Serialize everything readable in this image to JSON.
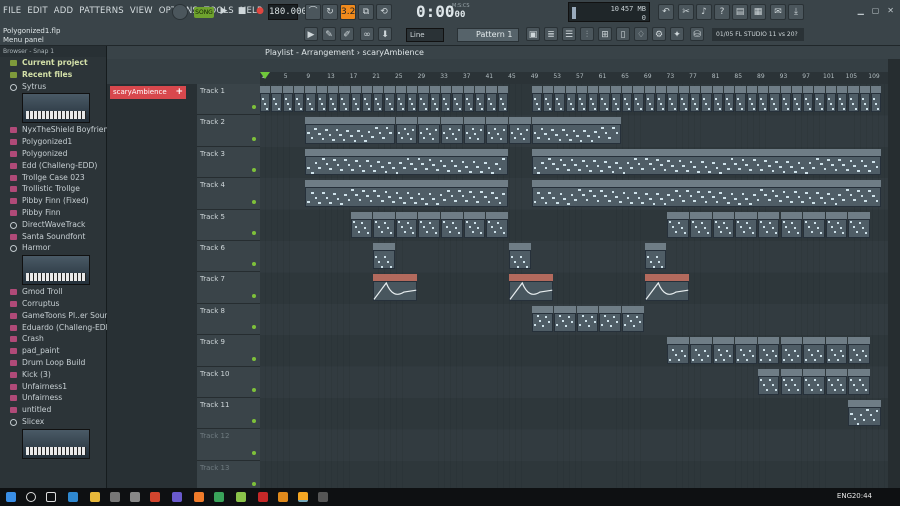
{
  "menu": [
    "FILE",
    "EDIT",
    "ADD",
    "PATTERNS",
    "VIEW",
    "OPTIONS",
    "TOOLS",
    "HELP"
  ],
  "project": {
    "file": "Polygonized1.flp",
    "hint": "Menu panel"
  },
  "transport": {
    "song_label": "SONG",
    "bpm": "180.000",
    "time": "0:00",
    "time_small": "00",
    "mcs": "M:S:CS"
  },
  "cpu": {
    "cores": "10",
    "memory": "457 MB",
    "polyphony": "0"
  },
  "tool_strip": {
    "step_badge": "3.2",
    "line_mode": "Line",
    "pattern": "Pattern 1"
  },
  "news": "01/05  FL STUDIO 11 vs 20?",
  "browser": {
    "header": "Browser - Snap 1",
    "items": [
      {
        "label": "Current project",
        "kind": "sect"
      },
      {
        "label": "Recent files",
        "kind": "sect"
      },
      {
        "label": "Sytrus",
        "kind": "gear"
      },
      {
        "label": "",
        "kind": "thumb"
      },
      {
        "label": "NyxTheShield Boyfriend",
        "kind": "file"
      },
      {
        "label": "Polygonized1",
        "kind": "file"
      },
      {
        "label": "Polygonized",
        "kind": "file"
      },
      {
        "label": "Edd (Challeng-EDD)",
        "kind": "file"
      },
      {
        "label": "Trollge Case 023",
        "kind": "file"
      },
      {
        "label": "Trollistic Trollge",
        "kind": "file"
      },
      {
        "label": "Pibby Finn (Fixed)",
        "kind": "file"
      },
      {
        "label": "Pibby Finn",
        "kind": "file"
      },
      {
        "label": "DirectWaveTrack",
        "kind": "gear"
      },
      {
        "label": "Santa Soundfont",
        "kind": "file"
      },
      {
        "label": "Harmor",
        "kind": "gear"
      },
      {
        "label": "",
        "kind": "thumb"
      },
      {
        "label": "Gmod Troll",
        "kind": "file"
      },
      {
        "label": "Corruptus",
        "kind": "file"
      },
      {
        "label": "GameToons Pl..er Soundfont",
        "kind": "file"
      },
      {
        "label": "Eduardo (Challeng-EDD)",
        "kind": "file"
      },
      {
        "label": "Crash",
        "kind": "file"
      },
      {
        "label": "pad_paint",
        "kind": "file"
      },
      {
        "label": "Drum Loop Build",
        "kind": "file"
      },
      {
        "label": "Kick (3)",
        "kind": "file"
      },
      {
        "label": "Unfairness1",
        "kind": "file"
      },
      {
        "label": "Unfairness",
        "kind": "file"
      },
      {
        "label": "untitled",
        "kind": "file"
      },
      {
        "label": "Slicex",
        "kind": "gear"
      },
      {
        "label": "",
        "kind": "thumb"
      }
    ]
  },
  "playlist": {
    "title": "Playlist - Arrangement",
    "breadcrumb_sep": "›",
    "current": "scaryAmbience",
    "picker_item": "scaryAmbience",
    "bars": [
      "1",
      "5",
      "9",
      "13",
      "17",
      "21",
      "25",
      "29",
      "33",
      "37",
      "41",
      "45",
      "49",
      "53",
      "57",
      "61",
      "65",
      "69",
      "73",
      "77",
      "81",
      "85",
      "89",
      "93",
      "97",
      "101",
      "105",
      "109"
    ],
    "tracks": [
      "Track 1",
      "Track 2",
      "Track 3",
      "Track 4",
      "Track 5",
      "Track 6",
      "Track 7",
      "Track 8",
      "Track 9",
      "Track 10",
      "Track 11",
      "Track 12",
      "Track 13"
    ],
    "clips": [
      {
        "track": 1,
        "start": 1,
        "len": 2,
        "label": "Pa..5"
      },
      {
        "track": 1,
        "start": 3,
        "len": 2,
        "label": "Pa..3"
      },
      {
        "track": 1,
        "start": 5,
        "len": 2,
        "label": "Pa..5"
      },
      {
        "track": 1,
        "start": 7,
        "len": 2,
        "label": "Pa..5"
      },
      {
        "track": 1,
        "start": 9,
        "len": 2,
        "label": "Pa..3"
      },
      {
        "track": 1,
        "start": 11,
        "len": 2,
        "label": "Pa..5"
      },
      {
        "track": 1,
        "start": 13,
        "len": 2,
        "label": "Pa..5"
      },
      {
        "track": 1,
        "start": 15,
        "len": 2,
        "label": "Pa..3"
      },
      {
        "track": 1,
        "start": 17,
        "len": 2,
        "label": "Pa..5"
      },
      {
        "track": 1,
        "start": 19,
        "len": 2,
        "label": "Pa..5"
      },
      {
        "track": 1,
        "start": 21,
        "len": 2,
        "label": "Pa..3"
      },
      {
        "track": 1,
        "start": 23,
        "len": 2,
        "label": "Pa..5"
      },
      {
        "track": 1,
        "start": 25,
        "len": 2,
        "label": "Pa..5"
      },
      {
        "track": 1,
        "start": 27,
        "len": 2,
        "label": "Pa..3"
      },
      {
        "track": 1,
        "start": 29,
        "len": 2,
        "label": "Pa..5"
      },
      {
        "track": 1,
        "start": 31,
        "len": 2,
        "label": "Pa..5"
      },
      {
        "track": 1,
        "start": 33,
        "len": 2,
        "label": "Pa..3"
      },
      {
        "track": 1,
        "start": 35,
        "len": 2,
        "label": "Pa..5"
      },
      {
        "track": 1,
        "start": 37,
        "len": 2,
        "label": "Pa..5"
      },
      {
        "track": 1,
        "start": 39,
        "len": 2,
        "label": "Pa..3"
      },
      {
        "track": 1,
        "start": 41,
        "len": 2,
        "label": "Pa..5"
      },
      {
        "track": 1,
        "start": 43,
        "len": 2,
        "label": "Pa..5"
      },
      {
        "track": 1,
        "start": 49,
        "len": 2,
        "label": "Pa..5"
      },
      {
        "track": 1,
        "start": 51,
        "len": 2,
        "label": "Pa..5"
      },
      {
        "track": 1,
        "start": 53,
        "len": 2,
        "label": "Pa..3"
      },
      {
        "track": 1,
        "start": 55,
        "len": 2,
        "label": "Pa..5"
      },
      {
        "track": 1,
        "start": 57,
        "len": 2,
        "label": "Pa..5"
      },
      {
        "track": 1,
        "start": 59,
        "len": 2,
        "label": "Pa..3"
      },
      {
        "track": 1,
        "start": 61,
        "len": 2,
        "label": "Pa..5"
      },
      {
        "track": 1,
        "start": 63,
        "len": 2,
        "label": "Pa..5"
      },
      {
        "track": 1,
        "start": 65,
        "len": 2,
        "label": "Pa..3"
      },
      {
        "track": 1,
        "start": 67,
        "len": 2,
        "label": "Pa..5"
      },
      {
        "track": 1,
        "start": 69,
        "len": 2,
        "label": "Pa..5"
      },
      {
        "track": 1,
        "start": 71,
        "len": 2,
        "label": "Pa..3"
      },
      {
        "track": 1,
        "start": 73,
        "len": 2,
        "label": "Pa..5"
      },
      {
        "track": 1,
        "start": 75,
        "len": 2,
        "label": "Pa..5"
      },
      {
        "track": 1,
        "start": 77,
        "len": 2,
        "label": "Pa..3"
      },
      {
        "track": 1,
        "start": 79,
        "len": 2,
        "label": "Pa..5"
      },
      {
        "track": 1,
        "start": 81,
        "len": 2,
        "label": "Pa..5"
      },
      {
        "track": 1,
        "start": 83,
        "len": 2,
        "label": "Pa..3"
      },
      {
        "track": 1,
        "start": 85,
        "len": 2,
        "label": "Pa..5"
      },
      {
        "track": 1,
        "start": 87,
        "len": 2,
        "label": "Pa..5"
      },
      {
        "track": 1,
        "start": 89,
        "len": 2,
        "label": "Pa..3"
      },
      {
        "track": 1,
        "start": 91,
        "len": 2,
        "label": "Pa..5"
      },
      {
        "track": 1,
        "start": 93,
        "len": 2,
        "label": "Pa..5"
      },
      {
        "track": 1,
        "start": 95,
        "len": 2,
        "label": "Pa..3"
      },
      {
        "track": 1,
        "start": 97,
        "len": 2,
        "label": "Pa..5"
      },
      {
        "track": 1,
        "start": 99,
        "len": 2,
        "label": "Pa..5"
      },
      {
        "track": 1,
        "start": 101,
        "len": 2,
        "label": "Pa..3"
      },
      {
        "track": 1,
        "start": 103,
        "len": 2,
        "label": "Pa..5"
      },
      {
        "track": 1,
        "start": 105,
        "len": 2,
        "label": "Pa..5"
      },
      {
        "track": 1,
        "start": 107,
        "len": 2,
        "label": "Pa..3"
      },
      {
        "track": 1,
        "start": 109,
        "len": 2,
        "label": "Pa..5"
      },
      {
        "track": 2,
        "start": 9,
        "len": 16,
        "label": "Pattern 1"
      },
      {
        "track": 2,
        "start": 25,
        "len": 4,
        "label": "Pa..6"
      },
      {
        "track": 2,
        "start": 29,
        "len": 4,
        "label": "Pa..6"
      },
      {
        "track": 2,
        "start": 33,
        "len": 4,
        "label": "Pa..6"
      },
      {
        "track": 2,
        "start": 37,
        "len": 4,
        "label": "Pa..6"
      },
      {
        "track": 2,
        "start": 41,
        "len": 4,
        "label": "Pa..6"
      },
      {
        "track": 2,
        "start": 45,
        "len": 4,
        "label": "Pa..6"
      },
      {
        "track": 2,
        "start": 49,
        "len": 16,
        "label": "Pattern 1"
      },
      {
        "track": 3,
        "start": 9,
        "len": 36,
        "label": ""
      },
      {
        "track": 3,
        "start": 49,
        "len": 62,
        "label": ""
      },
      {
        "track": 4,
        "start": 9,
        "len": 36,
        "label": ""
      },
      {
        "track": 4,
        "start": 49,
        "len": 62,
        "label": ""
      },
      {
        "track": 5,
        "start": 17,
        "len": 4,
        "label": "pad"
      },
      {
        "track": 5,
        "start": 21,
        "len": 4,
        "label": "pad"
      },
      {
        "track": 5,
        "start": 25,
        "len": 4,
        "label": "pad"
      },
      {
        "track": 5,
        "start": 29,
        "len": 4,
        "label": "pad"
      },
      {
        "track": 5,
        "start": 33,
        "len": 4,
        "label": "pad"
      },
      {
        "track": 5,
        "start": 37,
        "len": 4,
        "label": "pad"
      },
      {
        "track": 5,
        "start": 41,
        "len": 4,
        "label": "pad"
      },
      {
        "track": 5,
        "start": 73,
        "len": 4,
        "label": "pad"
      },
      {
        "track": 5,
        "start": 77,
        "len": 4,
        "label": "pad"
      },
      {
        "track": 5,
        "start": 81,
        "len": 4,
        "label": "pad"
      },
      {
        "track": 5,
        "start": 85,
        "len": 4,
        "label": "pad"
      },
      {
        "track": 5,
        "start": 89,
        "len": 4,
        "label": "pad"
      },
      {
        "track": 5,
        "start": 93,
        "len": 4,
        "label": "pad"
      },
      {
        "track": 5,
        "start": 97,
        "len": 4,
        "label": "pad"
      },
      {
        "track": 5,
        "start": 101,
        "len": 4,
        "label": "pad"
      },
      {
        "track": 5,
        "start": 105,
        "len": 4,
        "label": "pad"
      },
      {
        "track": 6,
        "start": 21,
        "len": 4,
        "label": "riser"
      },
      {
        "track": 6,
        "start": 45,
        "len": 4,
        "label": "riser"
      },
      {
        "track": 6,
        "start": 69,
        "len": 4,
        "label": "riser"
      },
      {
        "track": 7,
        "start": 21,
        "len": 8,
        "label": "Capacit...Pitch",
        "auto": true
      },
      {
        "track": 7,
        "start": 45,
        "len": 8,
        "label": "Capacit...Pitch",
        "auto": true
      },
      {
        "track": 7,
        "start": 69,
        "len": 8,
        "label": "Capacit...Pitch",
        "auto": true
      },
      {
        "track": 8,
        "start": 49,
        "len": 4,
        "label": "Pa..7"
      },
      {
        "track": 8,
        "start": 53,
        "len": 4,
        "label": "Pa..7"
      },
      {
        "track": 8,
        "start": 57,
        "len": 4,
        "label": "Pa..7"
      },
      {
        "track": 8,
        "start": 61,
        "len": 4,
        "label": "Pa..7"
      },
      {
        "track": 8,
        "start": 65,
        "len": 4,
        "label": "Pa..7"
      },
      {
        "track": 9,
        "start": 73,
        "len": 4,
        "label": "Pa..8"
      },
      {
        "track": 9,
        "start": 77,
        "len": 4,
        "label": "Pa..8"
      },
      {
        "track": 9,
        "start": 81,
        "len": 4,
        "label": "Pa..8"
      },
      {
        "track": 9,
        "start": 85,
        "len": 4,
        "label": "Pa..8"
      },
      {
        "track": 9,
        "start": 89,
        "len": 4,
        "label": "Pa..8"
      },
      {
        "track": 9,
        "start": 93,
        "len": 4,
        "label": "Pa..8"
      },
      {
        "track": 9,
        "start": 97,
        "len": 4,
        "label": "Pa..8"
      },
      {
        "track": 9,
        "start": 101,
        "len": 4,
        "label": "Pa..8"
      },
      {
        "track": 9,
        "start": 105,
        "len": 4,
        "label": "Pa..8"
      },
      {
        "track": 10,
        "start": 89,
        "len": 4,
        "label": "Pa..9"
      },
      {
        "track": 10,
        "start": 93,
        "len": 4,
        "label": "Pa..9"
      },
      {
        "track": 10,
        "start": 97,
        "len": 4,
        "label": "Pa..9"
      },
      {
        "track": 10,
        "start": 101,
        "len": 4,
        "label": "Pa..9"
      },
      {
        "track": 10,
        "start": 105,
        "len": 4,
        "label": "Pa..9"
      },
      {
        "track": 11,
        "start": 105,
        "len": 6,
        "label": ""
      }
    ]
  },
  "taskbar": {
    "lang": "ENG",
    "clock": "20:44"
  }
}
